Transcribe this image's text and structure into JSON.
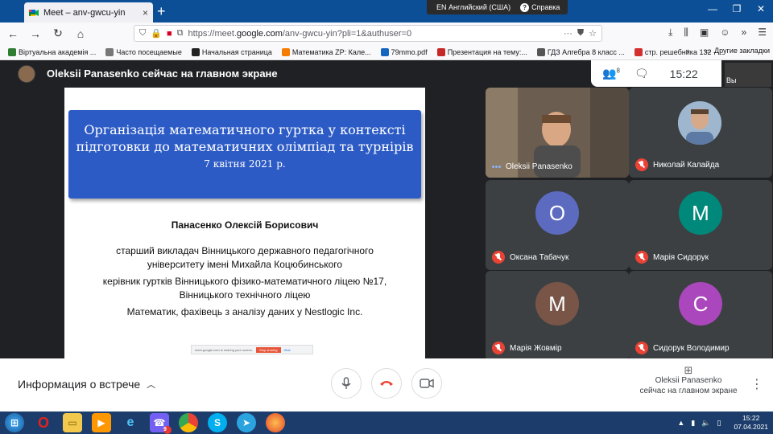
{
  "browser": {
    "tab_title": "Meet – anv-gwcu-yin",
    "tab_close": "×",
    "new_tab": "+",
    "tray_lang": "EN Английский (США)",
    "tray_help": "Справка",
    "url_prefix": "https://meet.",
    "url_domain": "google.com",
    "url_rest": "/anv-gwcu-yin?pli=1&authuser=0",
    "url_more": "···",
    "bookmarks": [
      {
        "label": "Віртуальна академія ...",
        "color": "#2e7d32"
      },
      {
        "label": "Часто посещаемые",
        "color": "#777777"
      },
      {
        "label": "Начальная страница",
        "color": "#222222"
      },
      {
        "label": "Математика ZP: Кале...",
        "color": "#f57c00"
      },
      {
        "label": "79mmo.pdf",
        "color": "#1565c0"
      },
      {
        "label": "Презентация на тему:...",
        "color": "#c62828"
      },
      {
        "label": "ГДЗ Алгебра 8 класс ...",
        "color": "#555555"
      },
      {
        "label": "стр. решебника 132 - ...",
        "color": "#d32f2f"
      }
    ],
    "bookmarks_more": "»",
    "other_bookmarks": "Другие закладки"
  },
  "meet": {
    "presenter_banner": "Oleksii Panasenko сейчас на главном экране",
    "participant_count": "8",
    "time": "15:22",
    "self_label": "Вы",
    "slide": {
      "title": "Організація математичного гуртка у контексті підготовки до математичних олімпіад та турнірів",
      "date": "7 квітня 2021 р.",
      "author": "Панасенко Олексій Борисович",
      "lines": [
        "старший викладач Вінницького державного педагогічного",
        "університету імені Михайла Коцюбинського",
        "керівник гуртків Вінницького фізико-математичного ліцею №17,",
        "Вінницького технічного ліцею",
        "Математик, фахівець з аналізу даних у Nestlogic Inc."
      ],
      "share_text": "meet.google.com is sharing your screen.",
      "stop_sharing": "Stop sharing",
      "hide": "Hide"
    },
    "participants": [
      {
        "name": "Oleksii Panasenko",
        "speaking": true
      },
      {
        "name": "Николай Калайда",
        "muted": true
      },
      {
        "name": "Оксана Табачук",
        "initial": "О",
        "color": "#5c6bc0",
        "muted": true
      },
      {
        "name": "Марія Сидорук",
        "initial": "М",
        "color": "#00897b",
        "muted": true
      },
      {
        "name": "Марія Жовмір",
        "initial": "М",
        "color": "#795548",
        "muted": true
      },
      {
        "name": "Сидорук Володимир",
        "initial": "С",
        "color": "#ab47bc",
        "muted": true
      }
    ],
    "meeting_info": "Информация о встрече",
    "present_line1": "Oleksii Panasenko",
    "present_line2": "сейчас на главном экране"
  },
  "taskbar": {
    "viber_badge": "9",
    "clock_time": "15:22",
    "clock_date": "07.04.2021"
  }
}
